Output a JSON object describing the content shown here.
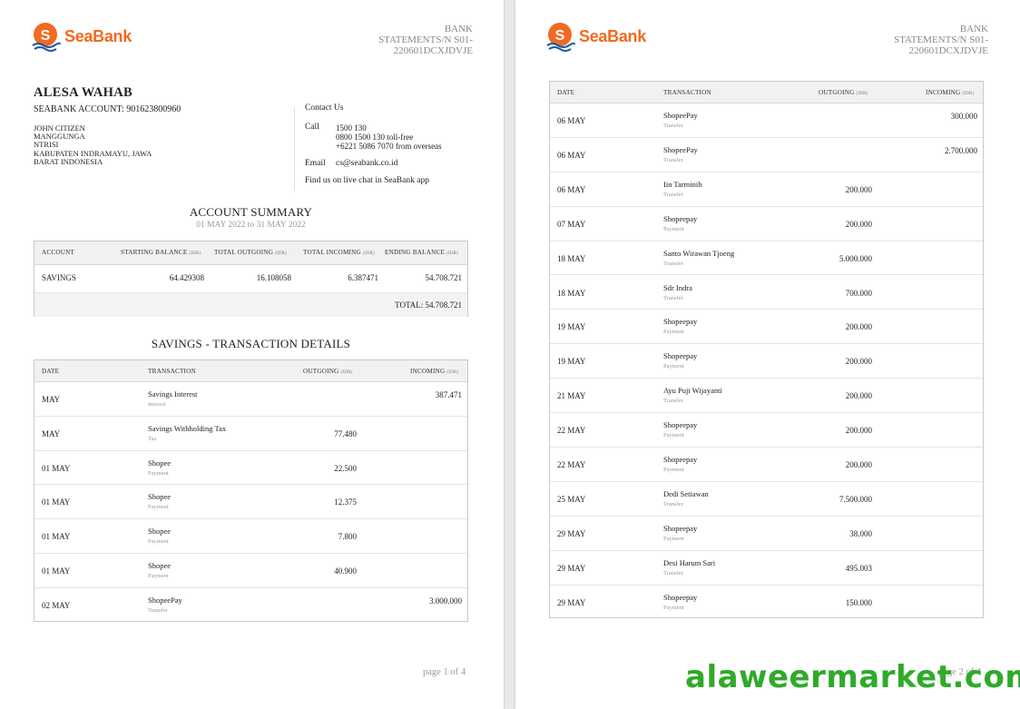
{
  "brand": {
    "name": "SeaBank",
    "color": "#f16a21"
  },
  "statement_ref": [
    "BANK",
    "STATEMENTS/N S01-",
    "220601DCXJDVJE"
  ],
  "account": {
    "holder": "ALESA WAHAB",
    "number_line": "SEABANK ACCOUNT: 901623800960",
    "address": [
      "JOHN CITIZEN",
      "MANGGUNGA",
      "NTRISI",
      "KABUPATEN INDRAMAYU, JAWA",
      "BARAT INDONESIA"
    ]
  },
  "contact": {
    "title": "Contact Us",
    "call_label": "Call",
    "call_lines": [
      "1500 130",
      "0800 1500 130 toll-free",
      "+6221 5086 7070 from overseas"
    ],
    "email_label": "Email",
    "email": "cs@seabank.co.id",
    "chat": "Find us on live chat in SeaBank app"
  },
  "summary": {
    "title": "ACCOUNT SUMMARY",
    "period": "01 MAY 2022 to 31 MAY 2022",
    "headers": {
      "account": "ACCOUNT",
      "starting": "STARTING BALANCE",
      "outgoing": "TOTAL OUTGOING",
      "incoming": "TOTAL INCOMING",
      "ending": "ENDING BALANCE",
      "currency": "(IDR)"
    },
    "row": {
      "account": "SAVINGS",
      "starting": "64.429308",
      "outgoing": "16.108058",
      "incoming": "6.387471",
      "ending": "54.708.721"
    },
    "total": "TOTAL: 54.708.721"
  },
  "details": {
    "title": "SAVINGS - TRANSACTION DETAILS",
    "headers": {
      "date": "DATE",
      "transaction": "TRANSACTION",
      "outgoing": "OUTGOING",
      "incoming": "INCOMING",
      "currency": "(IDR)"
    }
  },
  "page1_rows": [
    {
      "date": "MAY",
      "name": "Savings  Interest",
      "type": "Interest",
      "outgoing": "",
      "incoming": "387.471"
    },
    {
      "date": "MAY",
      "name": "Savings Withholding Tax",
      "type": "Tax",
      "outgoing": "77.480",
      "incoming": ""
    },
    {
      "date": "01 MAY",
      "name": "Shopee",
      "type": "Payment",
      "outgoing": "22.500",
      "incoming": ""
    },
    {
      "date": "01 MAY",
      "name": "Shopee",
      "type": "Payment",
      "outgoing": "12.375",
      "incoming": ""
    },
    {
      "date": "01 MAY",
      "name": "Shopee",
      "type": "Payment",
      "outgoing": "7.800",
      "incoming": ""
    },
    {
      "date": "01 MAY",
      "name": "Shopee",
      "type": "Payment",
      "outgoing": "40.900",
      "incoming": ""
    },
    {
      "date": "02 MAY",
      "name": "ShopeePay",
      "type": "Transfer",
      "outgoing": "",
      "incoming": "3.000.000"
    }
  ],
  "page2_rows": [
    {
      "date": "06 MAY",
      "name": "ShopeePay",
      "type": "Transfer",
      "outgoing": "",
      "incoming": "300.000"
    },
    {
      "date": "06 MAY",
      "name": "ShopeePay",
      "type": "Transfer",
      "outgoing": "",
      "incoming": "2.700.000"
    },
    {
      "date": "06 MAY",
      "name": "Iin Tarminih",
      "type": "Transfer",
      "outgoing": "200.000",
      "incoming": ""
    },
    {
      "date": "07 MAY",
      "name": "Shopeepay",
      "type": "Payment",
      "outgoing": "200.000",
      "incoming": ""
    },
    {
      "date": "18 MAY",
      "name": "Santo Wirawan Tjoeng",
      "type": "Transfer",
      "outgoing": "5.000.000",
      "incoming": ""
    },
    {
      "date": "18 MAY",
      "name": "Sdr Indra",
      "type": "Transfer",
      "outgoing": "700.000",
      "incoming": ""
    },
    {
      "date": "19 MAY",
      "name": "Shopeepay",
      "type": "Payment",
      "outgoing": "200.000",
      "incoming": ""
    },
    {
      "date": "19 MAY",
      "name": "Shopeepay",
      "type": "Payment",
      "outgoing": "200.000",
      "incoming": ""
    },
    {
      "date": "21 MAY",
      "name": "Ayu Puji Wijayanti",
      "type": "Transfer",
      "outgoing": "200.000",
      "incoming": ""
    },
    {
      "date": "22 MAY",
      "name": "Shopeepay",
      "type": "Payment",
      "outgoing": "200.000",
      "incoming": ""
    },
    {
      "date": "22 MAY",
      "name": "Shopeepay",
      "type": "Payment",
      "outgoing": "200.000",
      "incoming": ""
    },
    {
      "date": "25 MAY",
      "name": "Dedi Setiawan",
      "type": "Transfer",
      "outgoing": "7.500.000",
      "incoming": ""
    },
    {
      "date": "29 MAY",
      "name": "Shopeepay",
      "type": "Payment",
      "outgoing": "38.000",
      "incoming": ""
    },
    {
      "date": "29 MAY",
      "name": "Desi Harum Sari",
      "type": "Transfer",
      "outgoing": "495.003",
      "incoming": ""
    },
    {
      "date": "29 MAY",
      "name": "Shopeepay",
      "type": "Payment",
      "outgoing": "150.000",
      "incoming": ""
    }
  ],
  "footer": {
    "page1": "page 1 of 4",
    "page2": "page 2 of 4"
  },
  "watermark": "alaweermarket.com"
}
